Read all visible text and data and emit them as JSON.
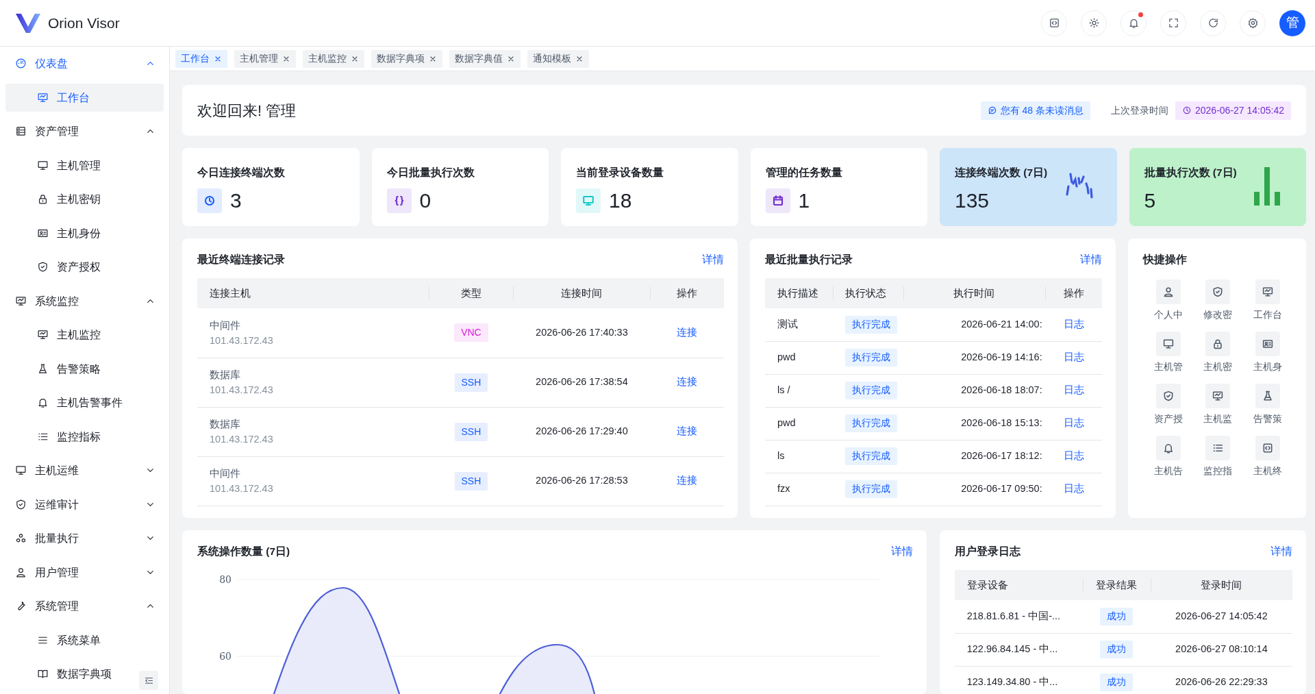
{
  "header": {
    "app_name": "Orion Visor",
    "notification_dot": true,
    "avatar": "管"
  },
  "sidebar": {
    "items": [
      {
        "label": "仪表盘",
        "expanded": true,
        "children": [
          {
            "label": "工作台",
            "selected": true
          }
        ]
      },
      {
        "label": "资产管理",
        "expanded": true,
        "children": [
          {
            "label": "主机管理",
            "selected": false
          },
          {
            "label": "主机密钥",
            "selected": false
          },
          {
            "label": "主机身份",
            "selected": false
          },
          {
            "label": "资产授权",
            "selected": false
          }
        ]
      },
      {
        "label": "系统监控",
        "expanded": true,
        "children": [
          {
            "label": "主机监控",
            "selected": false
          },
          {
            "label": "告警策略",
            "selected": false
          },
          {
            "label": "主机告警事件",
            "selected": false
          },
          {
            "label": "监控指标",
            "selected": false
          }
        ]
      },
      {
        "label": "主机运维",
        "expanded": false
      },
      {
        "label": "运维审计",
        "expanded": false
      },
      {
        "label": "批量执行",
        "expanded": false
      },
      {
        "label": "用户管理",
        "expanded": false
      },
      {
        "label": "系统管理",
        "expanded": true,
        "children": [
          {
            "label": "系统菜单",
            "selected": false
          },
          {
            "label": "数据字典项",
            "selected": false
          }
        ]
      }
    ]
  },
  "tabs": [
    {
      "label": "工作台",
      "selected": true
    },
    {
      "label": "主机管理",
      "selected": false
    },
    {
      "label": "主机监控",
      "selected": false
    },
    {
      "label": "数据字典项",
      "selected": false
    },
    {
      "label": "数据字典值",
      "selected": false
    },
    {
      "label": "通知模板",
      "selected": false
    }
  ],
  "welcome": {
    "title": "欢迎回来! 管理",
    "unread": "您有 48 条未读消息",
    "last_login_label": "上次登录时间",
    "last_login_time": "2026-06-27 14:05:42"
  },
  "stats": [
    {
      "kind": "icon",
      "title": "今日连接终端次数",
      "value": "3",
      "color": "#165dff"
    },
    {
      "kind": "icon",
      "title": "今日批量执行次数",
      "value": "0",
      "color": "#722ed1"
    },
    {
      "kind": "icon",
      "title": "当前登录设备数量",
      "value": "18",
      "color": "#14c9c9"
    },
    {
      "kind": "icon",
      "title": "管理的任务数量",
      "value": "1",
      "color": "#722ed1"
    },
    {
      "kind": "sparkline",
      "title": "连接终端次数 (7日)",
      "value": "135",
      "color": "#3d5be0"
    },
    {
      "kind": "bars",
      "title": "批量执行次数 (7日)",
      "value": "5",
      "color": "#2ea64a"
    }
  ],
  "terminal_log": {
    "title": "最近终端连接记录",
    "link": "详情",
    "columns": [
      "连接主机",
      "类型",
      "连接时间",
      "操作"
    ],
    "rows": [
      {
        "name": "中间件",
        "address": "101.43.172.43",
        "type": "VNC",
        "color": "#d91ad9",
        "time": "2026-06-26 17:40:33",
        "action": "连接"
      },
      {
        "name": "数据库",
        "address": "101.43.172.43",
        "type": "SSH",
        "color": "#165dff",
        "time": "2026-06-26 17:38:54",
        "action": "连接"
      },
      {
        "name": "数据库",
        "address": "101.43.172.43",
        "type": "SSH",
        "color": "#165dff",
        "time": "2026-06-26 17:29:40",
        "action": "连接"
      },
      {
        "name": "中间件",
        "address": "101.43.172.43",
        "type": "SSH",
        "color": "#165dff",
        "time": "2026-06-26 17:28:53",
        "action": "连接"
      }
    ]
  },
  "batch_log": {
    "title": "最近批量执行记录",
    "link": "详情",
    "columns": [
      "执行描述",
      "执行状态",
      "执行时间",
      "操作"
    ],
    "rows": [
      {
        "description": "测试",
        "status": "执行完成",
        "time": "2026-06-21 14:00:",
        "action": "日志"
      },
      {
        "description": "pwd",
        "status": "执行完成",
        "time": "2026-06-19 14:16:",
        "action": "日志"
      },
      {
        "description": "ls /",
        "status": "执行完成",
        "time": "2026-06-18 18:07:",
        "action": "日志"
      },
      {
        "description": "pwd",
        "status": "执行完成",
        "time": "2026-06-18 15:13:",
        "action": "日志"
      },
      {
        "description": "ls",
        "status": "执行完成",
        "time": "2026-06-17 18:12:",
        "action": "日志"
      },
      {
        "description": "fzx",
        "status": "执行完成",
        "time": "2026-06-17 09:50:",
        "action": "日志"
      }
    ]
  },
  "quick_actions": {
    "title": "快捷操作",
    "items": [
      "个人中",
      "修改密",
      "工作台",
      "主机管",
      "主机密",
      "主机身",
      "资产授",
      "主机监",
      "告警策",
      "主机告",
      "监控指",
      "主机终"
    ]
  },
  "operations_chart": {
    "title": "系统操作数量 (7日)",
    "link": "详情",
    "y_axis_labels": [
      "80",
      "60"
    ]
  },
  "login_log": {
    "title": "用户登录日志",
    "link": "详情",
    "columns": [
      "登录设备",
      "登录结果",
      "登录时间"
    ],
    "rows": [
      {
        "device": "218.81.6.81 - 中国-...",
        "result": "成功",
        "time": "2026-06-27 14:05:42"
      },
      {
        "device": "122.96.84.145 - 中...",
        "result": "成功",
        "time": "2026-06-27 08:10:14"
      },
      {
        "device": "123.149.34.80 - 中...",
        "result": "成功",
        "time": "2026-06-26 22:29:33"
      }
    ]
  }
}
